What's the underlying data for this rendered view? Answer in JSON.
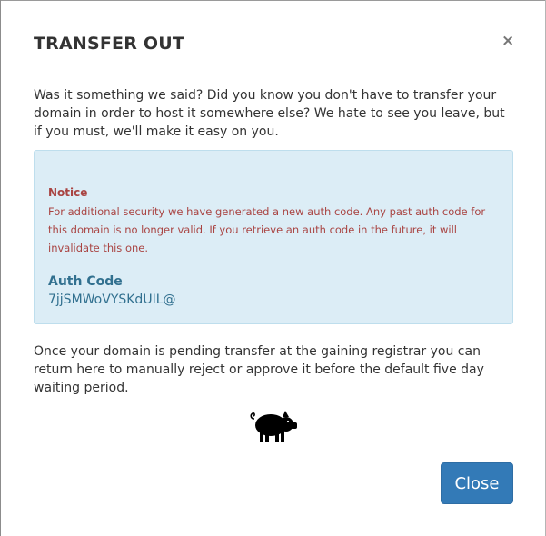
{
  "modal": {
    "title": "TRANSFER OUT",
    "close_symbol": "×",
    "intro_text": "Was it something we said? Did you know you don't have to transfer your domain in order to host it somewhere else? We hate to see you leave, but if you must, we'll make it easy on you.",
    "notice": {
      "label": "Notice",
      "text": "For additional security we have generated a new auth code. Any past auth code for this domain is no longer valid. If you retrieve an auth code in the future, it will invalidate this one."
    },
    "auth_code": {
      "label": "Auth Code",
      "value": "7jjSMWoVYSKdUIL@"
    },
    "outro_text": "Once your domain is pending transfer at the gaining registrar you can return here to manually reject or approve it before the default five day waiting period.",
    "mascot_icon": "pig-icon",
    "close_button_label": "Close"
  },
  "colors": {
    "primary": "#337ab7",
    "notice_bg": "#dcedf6",
    "notice_text": "#a94442",
    "info_text": "#31708f"
  }
}
